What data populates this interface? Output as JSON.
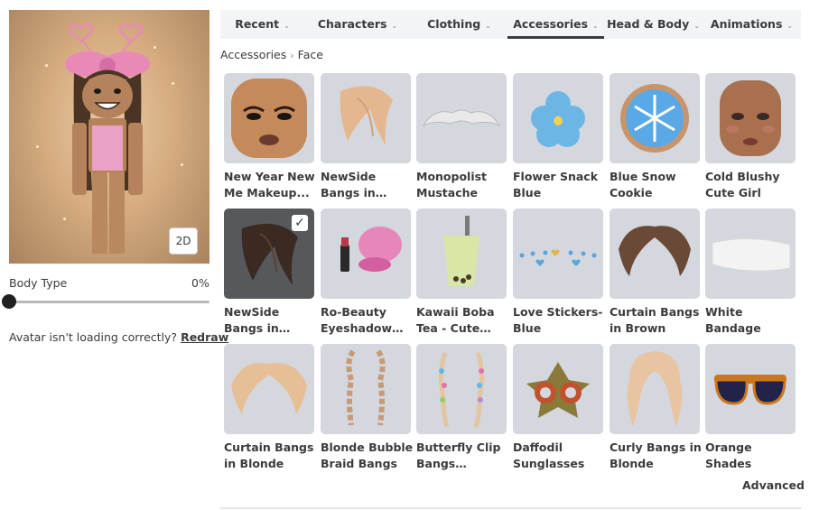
{
  "avatar": {
    "view_toggle": "2D",
    "body_type_label": "Body Type",
    "body_type_value": "0%",
    "loading_text": "Avatar isn't loading correctly?",
    "redraw_label": "Redraw"
  },
  "tabs": [
    {
      "label": "Recent"
    },
    {
      "label": "Characters"
    },
    {
      "label": "Clothing"
    },
    {
      "label": "Accessories",
      "active": true
    },
    {
      "label": "Head & Body"
    },
    {
      "label": "Animations"
    }
  ],
  "breadcrumb": {
    "parent": "Accessories",
    "current": "Face"
  },
  "items": [
    {
      "name": "New Year New Me Makeup..."
    },
    {
      "name": "NewSide Bangs in Blonde"
    },
    {
      "name": "Monopolist Mustache"
    },
    {
      "name": "Flower Snack Blue"
    },
    {
      "name": "Blue Snow Cookie"
    },
    {
      "name": "Cold Blushy Cute Girl"
    },
    {
      "name": "NewSide Bangs in Brown",
      "selected": true
    },
    {
      "name": "Ro-Beauty Eyeshadow &..."
    },
    {
      "name": "Kawaii Boba Tea - Cute Green..."
    },
    {
      "name": "Love Stickers-Blue"
    },
    {
      "name": "Curtain Bangs in Brown"
    },
    {
      "name": "White Bandage"
    },
    {
      "name": "Curtain Bangs in Blonde"
    },
    {
      "name": "Blonde Bubble Braid Bangs"
    },
    {
      "name": "Butterfly Clip Bangs [Blonde]"
    },
    {
      "name": "Daffodil Sunglasses"
    },
    {
      "name": "Curly Bangs in Blonde"
    },
    {
      "name": "Orange Shades"
    }
  ],
  "advanced_label": "Advanced",
  "colors": {
    "tab_bg": "#f2f4f5",
    "thumb_bg": "#d4d7dd",
    "selected_bg": "#56585b",
    "text": "#393b3d"
  }
}
